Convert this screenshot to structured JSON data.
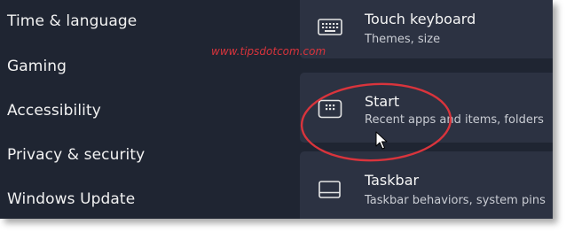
{
  "sidebar": {
    "items": [
      {
        "label": "Time & language"
      },
      {
        "label": "Gaming"
      },
      {
        "label": "Accessibility"
      },
      {
        "label": "Privacy & security"
      },
      {
        "label": "Windows Update"
      }
    ]
  },
  "settings": {
    "cards": [
      {
        "title": "Touch keyboard",
        "subtitle": "Themes, size",
        "icon": "keyboard-icon"
      },
      {
        "title": "Start",
        "subtitle": "Recent apps and items, folders",
        "icon": "start-menu-icon"
      },
      {
        "title": "Taskbar",
        "subtitle": "Taskbar behaviors, system pins",
        "icon": "taskbar-icon"
      }
    ]
  },
  "watermark": {
    "text": "www.tipsdotcom.com"
  },
  "colors": {
    "background": "#1f2532",
    "card": "#2c3242",
    "annotation_red": "#d9343c"
  }
}
